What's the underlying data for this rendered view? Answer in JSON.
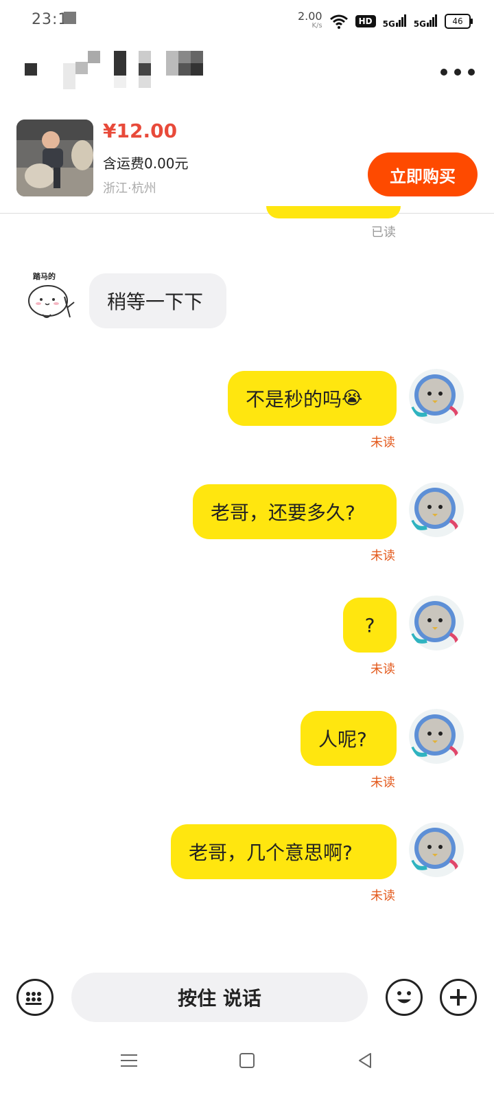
{
  "status_bar": {
    "time": "23:1",
    "speed_value": "2.00",
    "speed_unit": "K/s",
    "hd_label": "HD",
    "network_1": "5G",
    "network_2": "5G",
    "battery": "46"
  },
  "header": {
    "title_pixelated": true,
    "more_icon": "more-dots-icon"
  },
  "product": {
    "price": "¥12.00",
    "shipping": "含运费0.00元",
    "location": "浙江·杭州",
    "buy_label": "立即购买",
    "price_color": "#e84a3a",
    "buy_color": "#fe4a00"
  },
  "messages": [
    {
      "from": "me",
      "text": "",
      "status": "已读",
      "partial": true
    },
    {
      "from": "other",
      "text": "稍等一下下",
      "sticker_text": "踏马的"
    },
    {
      "from": "me",
      "text": "不是秒的吗",
      "emoji": "😭",
      "status": "未读"
    },
    {
      "from": "me",
      "text": "老哥，还要多久?",
      "status": "未读"
    },
    {
      "from": "me",
      "text": "?",
      "status": "未读"
    },
    {
      "from": "me",
      "text": "人呢?",
      "status": "未读"
    },
    {
      "from": "me",
      "text": "老哥，几个意思啊?",
      "status": "未读"
    }
  ],
  "input_bar": {
    "voice_label": "按住 说话",
    "left_icon": "keyboard-icon",
    "emoji_icon": "emoji-icon",
    "plus_icon": "plus-icon"
  },
  "colors": {
    "bubble_mine": "#ffe60f",
    "bubble_other": "#f1f1f3",
    "unread": "#e35a1d"
  }
}
